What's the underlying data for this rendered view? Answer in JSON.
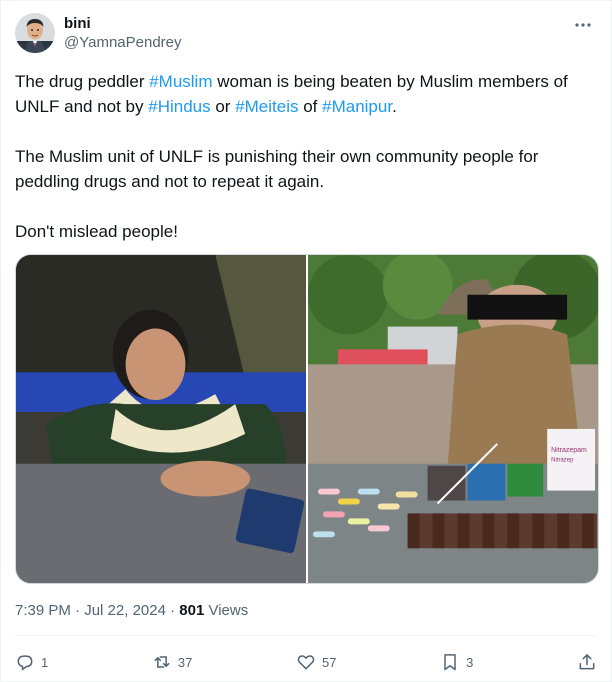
{
  "author": {
    "display_name": "bini",
    "handle": "@YamnaPendrey"
  },
  "tweet": {
    "p1_a": "The drug peddler ",
    "tag_muslim": "#Muslim",
    "p1_b": " woman is being beaten by Muslim members of UNLF  and not by ",
    "tag_hindus": "#Hindus",
    "p1_c": " or ",
    "tag_meiteis": "#Meiteis",
    "p1_d": " of ",
    "tag_manipur": "#Manipur",
    "p1_e": ".",
    "p2": "The Muslim unit of UNLF is punishing their own community people for peddling drugs and not to repeat it again.",
    "p3": "Don't mislead people!"
  },
  "media": {
    "box_label": "Nitrazepam",
    "box_label_sub": "Nitrazep"
  },
  "meta": {
    "time": "7:39 PM",
    "sep1": " · ",
    "date": "Jul 22, 2024",
    "sep2": " · ",
    "views_count": "801",
    "views_label": " Views"
  },
  "actions": {
    "replies": "1",
    "reposts": "37",
    "likes": "57",
    "bookmarks": "3"
  },
  "icons": {
    "more": "more-icon",
    "reply": "reply-icon",
    "repost": "repost-icon",
    "like": "heart-icon",
    "bookmark": "bookmark-icon",
    "share": "share-icon"
  },
  "colors": {
    "text": "#0f1419",
    "secondary": "#536471",
    "link": "#1d9bf0",
    "border": "#eff3f4"
  }
}
